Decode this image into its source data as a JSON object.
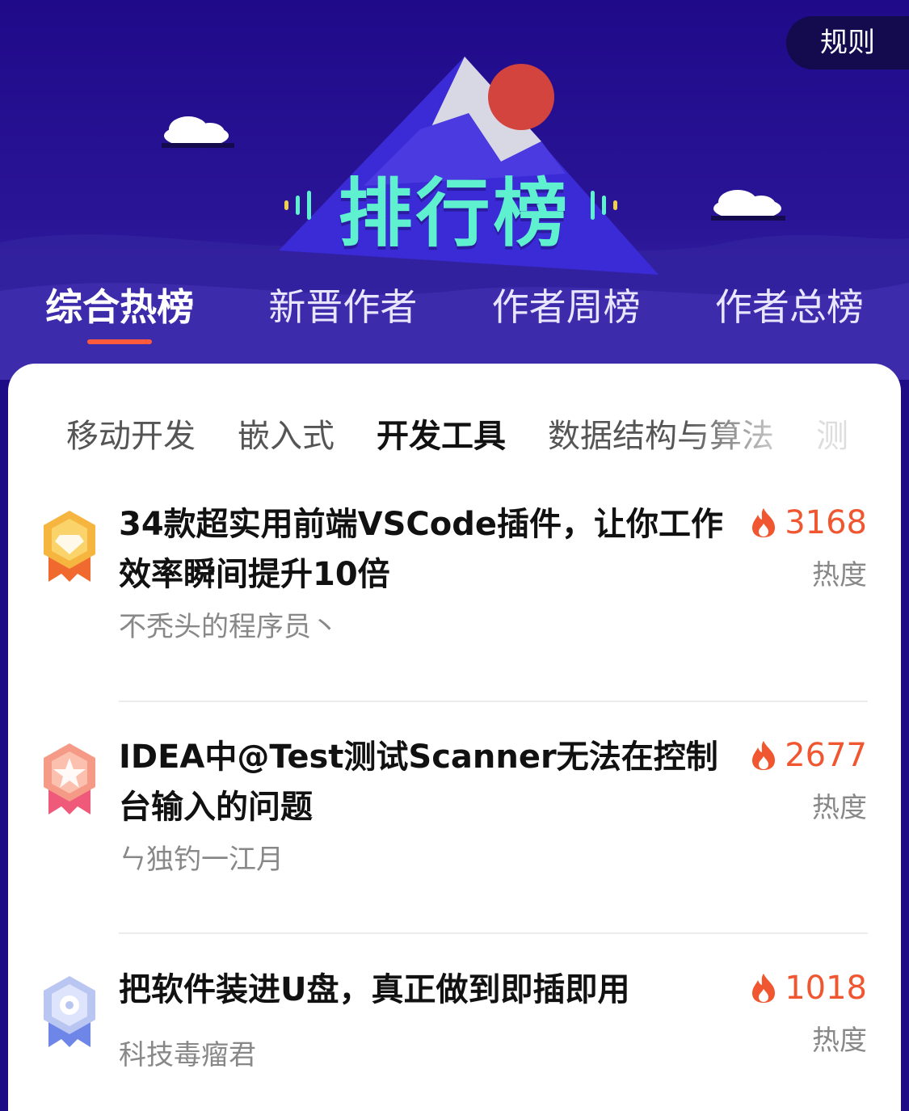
{
  "header": {
    "rules_label": "规则",
    "hero_title": "排行榜"
  },
  "tabs": [
    {
      "label": "综合热榜",
      "active": true
    },
    {
      "label": "新晋作者",
      "active": false
    },
    {
      "label": "作者周榜",
      "active": false
    },
    {
      "label": "作者总榜",
      "active": false
    }
  ],
  "categories": [
    {
      "label": "移动开发"
    },
    {
      "label": "嵌入式"
    },
    {
      "label": "开发工具",
      "active": true
    },
    {
      "label": "数据结构与算法"
    },
    {
      "label": "测"
    }
  ],
  "items": [
    {
      "title": "34款超实用前端VSCode插件，让你工作效率瞬间提升10倍",
      "author": "不秃头的程序员丶",
      "heat": "3168",
      "heat_label": "热度",
      "medal_color": "#f5a623"
    },
    {
      "title": "IDEA中@Test测试Scanner无法在控制台输入的问题",
      "author": "ㄣ独钓一江月",
      "heat": "2677",
      "heat_label": "热度",
      "medal_color": "#f47a6a"
    },
    {
      "title": "把软件装进U盘，真正做到即插即用",
      "author": "科技毒瘤君",
      "heat": "1018",
      "heat_label": "热度",
      "medal_color": "#8fa4ee"
    }
  ]
}
